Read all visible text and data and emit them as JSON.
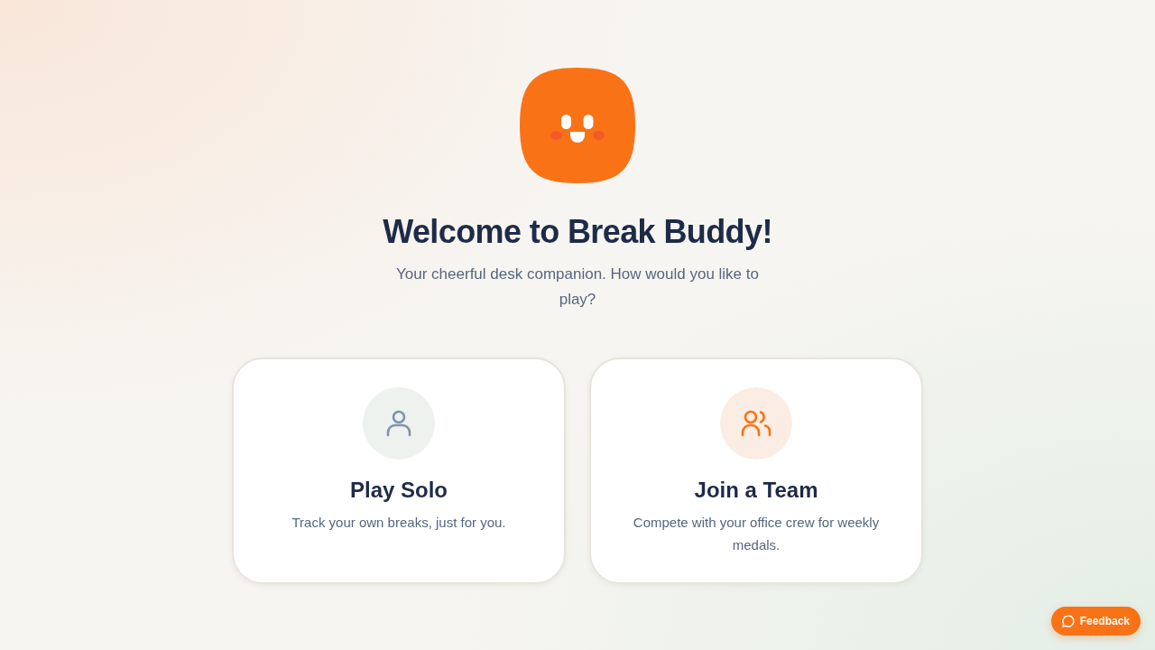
{
  "header": {
    "title": "Welcome to Break Buddy!",
    "subtitle": "Your cheerful desk companion. How would you like to play?"
  },
  "modes": [
    {
      "kind": "solo",
      "title": "Play Solo",
      "description": "Track your own breaks, just for you."
    },
    {
      "kind": "team",
      "title": "Join a Team",
      "description": "Compete with your office crew for weekly medals."
    }
  ],
  "feedback_button": {
    "label": "Feedback"
  }
}
